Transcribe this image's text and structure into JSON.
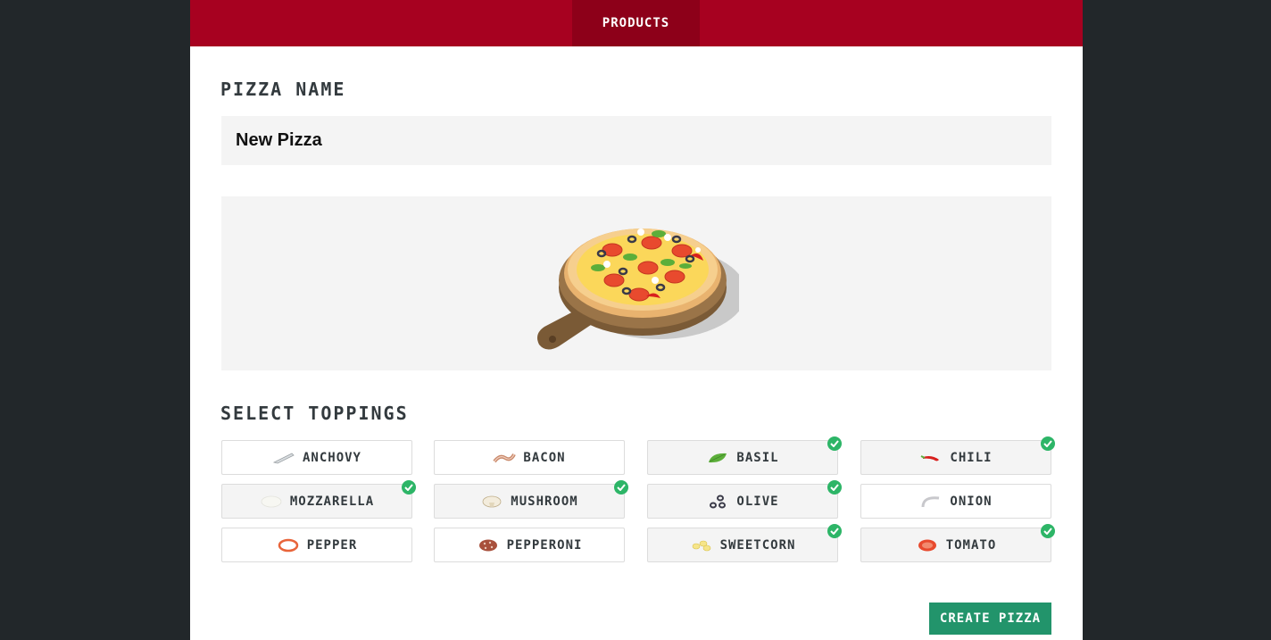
{
  "nav": {
    "tab_label": "PRODUCTS"
  },
  "form": {
    "name_title": "PIZZA NAME",
    "name_value": "New Pizza",
    "toppings_title": "SELECT TOPPINGS",
    "create_label": "CREATE PIZZA"
  },
  "toppings": [
    {
      "label": "ANCHOVY",
      "icon": "anchovy-icon",
      "selected": false
    },
    {
      "label": "BACON",
      "icon": "bacon-icon",
      "selected": false
    },
    {
      "label": "BASIL",
      "icon": "basil-icon",
      "selected": true
    },
    {
      "label": "CHILI",
      "icon": "chili-icon",
      "selected": true
    },
    {
      "label": "MOZZARELLA",
      "icon": "mozzarella-icon",
      "selected": true
    },
    {
      "label": "MUSHROOM",
      "icon": "mushroom-icon",
      "selected": true
    },
    {
      "label": "OLIVE",
      "icon": "olive-icon",
      "selected": true
    },
    {
      "label": "ONION",
      "icon": "onion-icon",
      "selected": false
    },
    {
      "label": "PEPPER",
      "icon": "pepper-icon",
      "selected": false
    },
    {
      "label": "PEPPERONI",
      "icon": "pepperoni-icon",
      "selected": false
    },
    {
      "label": "SWEETCORN",
      "icon": "sweetcorn-icon",
      "selected": true
    },
    {
      "label": "TOMATO",
      "icon": "tomato-icon",
      "selected": true
    }
  ],
  "colors": {
    "brand": "#a70120",
    "accent": "#22946b",
    "check": "#2db567"
  }
}
